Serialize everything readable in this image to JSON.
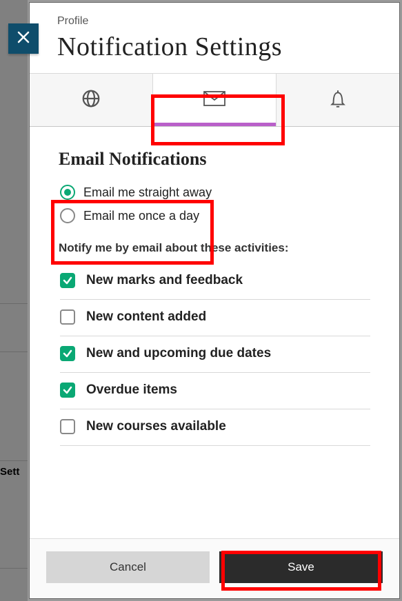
{
  "bg_sidebar_text": "Sett",
  "header": {
    "breadcrumb": "Profile",
    "title": "Notification Settings"
  },
  "tabs": {
    "globe": "globe-icon",
    "email": "mail-icon",
    "bell": "bell-icon",
    "active_index": 1
  },
  "section": {
    "heading": "Email Notifications",
    "radio_options": [
      {
        "label": "Email me straight away",
        "checked": true
      },
      {
        "label": "Email me once a day",
        "checked": false
      }
    ],
    "subheading": "Notify me by email about these activities:",
    "checkboxes": [
      {
        "label": "New marks and feedback",
        "checked": true
      },
      {
        "label": "New content added",
        "checked": false
      },
      {
        "label": "New and upcoming due dates",
        "checked": true
      },
      {
        "label": "Overdue items",
        "checked": true
      },
      {
        "label": "New courses available",
        "checked": false
      }
    ]
  },
  "footer": {
    "cancel": "Cancel",
    "save": "Save"
  },
  "colors": {
    "accent_green": "#0aa874",
    "tab_underline": "#b95fc9",
    "close_bg": "#0f4d6b"
  }
}
